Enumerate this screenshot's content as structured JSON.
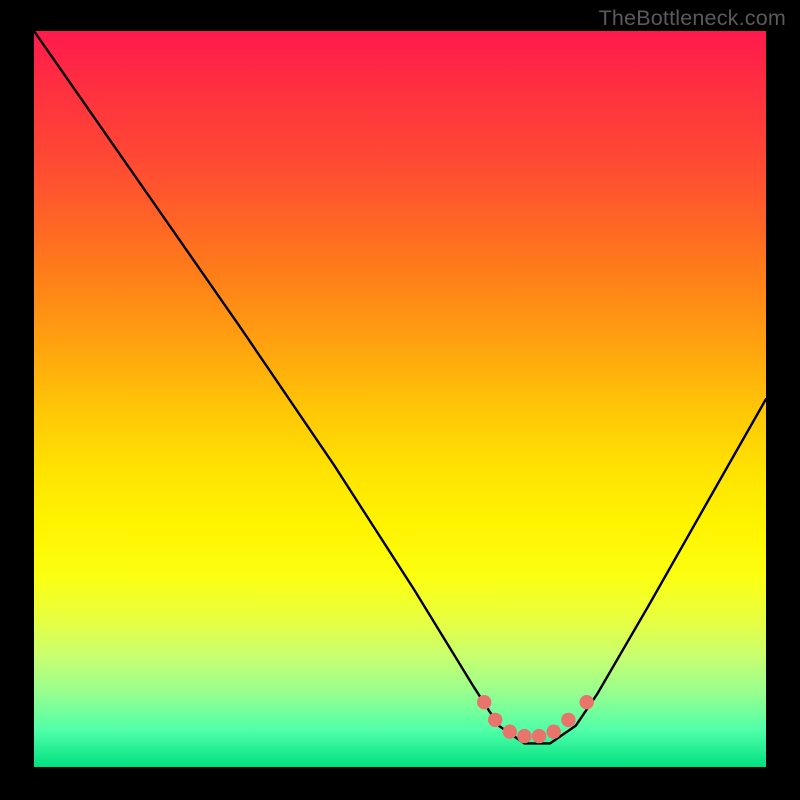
{
  "attribution": {
    "text": "TheBottleneck.com"
  },
  "chart_data": {
    "type": "line",
    "title": "",
    "xlabel": "",
    "ylabel": "",
    "xlim": [
      0,
      100
    ],
    "ylim": [
      0,
      100
    ],
    "series": [
      {
        "name": "curve",
        "x": [
          0,
          14,
          28,
          41,
          52,
          60,
          63.5,
          67,
          70.5,
          74,
          77,
          84,
          92,
          100
        ],
        "values": [
          100,
          80,
          60,
          41,
          24,
          11,
          5.6,
          3.2,
          3.2,
          5.6,
          10,
          22,
          36,
          50
        ]
      },
      {
        "name": "markers-salmon",
        "x": [
          61.5,
          63,
          65,
          67,
          69,
          71,
          73,
          75.5
        ],
        "values": [
          8.8,
          6.4,
          4.8,
          4.2,
          4.2,
          4.8,
          6.4,
          8.8
        ]
      }
    ],
    "colors": {
      "curve_stroke": "#000000",
      "marker_fill": "#e8746c",
      "background_top": "#ff1a4d",
      "background_bottom": "#00e080"
    }
  }
}
